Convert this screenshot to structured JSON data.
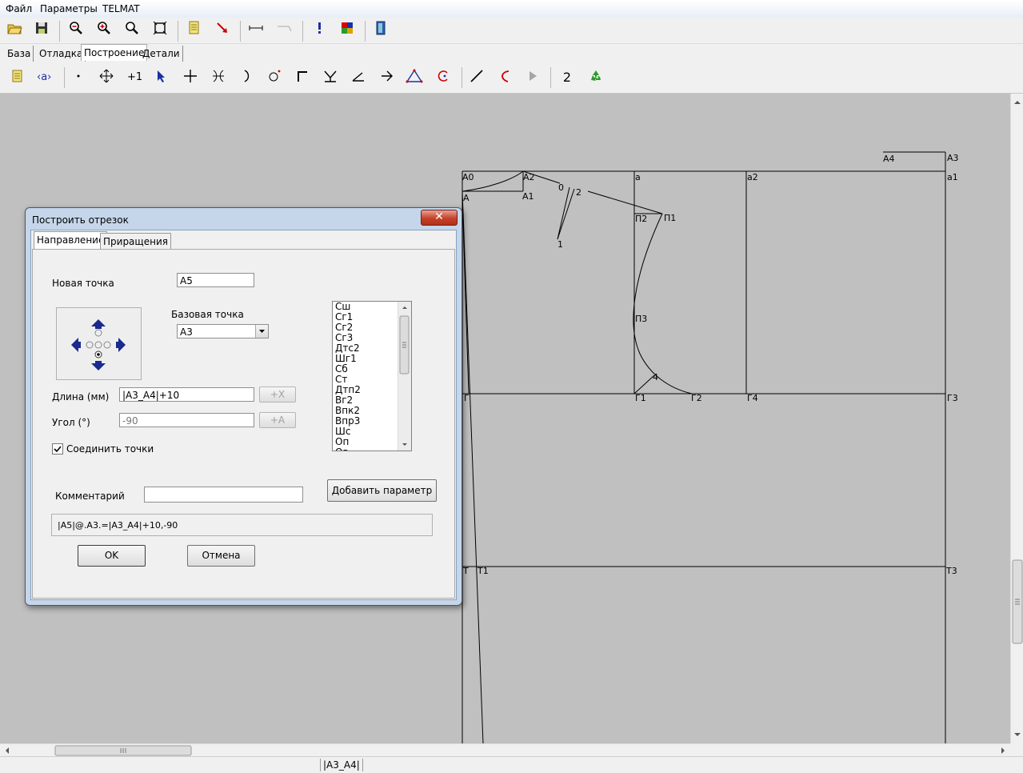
{
  "menu": [
    "Файл",
    "Параметры",
    "TELMAT"
  ],
  "main_tabs": [
    "База",
    "Отладка",
    "Построение",
    "Детали"
  ],
  "toolbar2": {
    "counter_label": "2"
  },
  "drawing": {
    "points": [
      "А4",
      "А3",
      "А0",
      "А2",
      "а",
      "а2",
      "а1",
      "А",
      "А1",
      "0",
      "2",
      "1",
      "П2",
      "П1",
      "П3",
      "4",
      "Г",
      "Г1",
      "Г2",
      "Г4",
      "Г3",
      "Т",
      "Т1",
      "Т3"
    ]
  },
  "dialog": {
    "title": "Построить отрезок",
    "close_glyph": "✕",
    "tabs": [
      "Направление",
      "Приращения"
    ],
    "new_point_label": "Новая точка",
    "new_point_value": "А5",
    "base_point_label": "Базовая точка",
    "base_point_value": "А3",
    "length_label": "Длина (мм)",
    "length_value": "|А3_А4|+10",
    "length_add_button": "+X",
    "angle_label": "Угол (°)",
    "angle_value": "-90",
    "angle_add_button": "+A",
    "connect_label": "Соединить точки",
    "connect_checked": true,
    "comment_label": "Комментарий",
    "comment_value": "",
    "add_param_button": "Добавить параметр",
    "formula": "|А5|@.А3.=|А3_А4|+10,-90",
    "ok_button": "OK",
    "cancel_button": "Отмена",
    "param_list": [
      "Сш",
      "Сг1",
      "Сг2",
      "Сг3",
      "Дтс2",
      "Шг1",
      "Сб",
      "Ст",
      "Дтп2",
      "Вг2",
      "Впк2",
      "Впр3",
      "Шс",
      "Оп",
      "Ог"
    ]
  },
  "status": {
    "text": "|А3_А4|"
  }
}
